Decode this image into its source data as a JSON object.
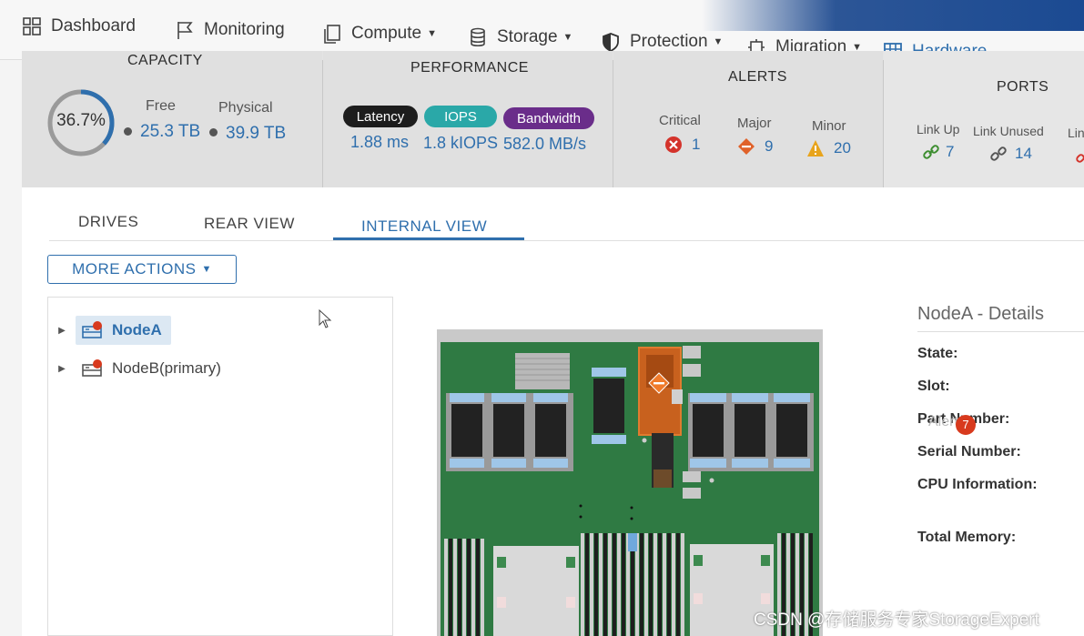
{
  "nav": {
    "items": [
      {
        "label": "Dashboard",
        "icon": "dashboard-grid-icon"
      },
      {
        "label": "Monitoring",
        "icon": "flag-icon"
      },
      {
        "label": "Compute",
        "icon": "copy-icon"
      },
      {
        "label": "Storage",
        "icon": "database-icon"
      },
      {
        "label": "Protection",
        "icon": "shield-icon"
      },
      {
        "label": "Migration",
        "icon": "migration-icon"
      },
      {
        "label": "Hardware",
        "icon": "hardware-grid-icon"
      }
    ],
    "active": "Hardware"
  },
  "capacity": {
    "title": "CAPACITY",
    "percent": "36.7%",
    "percent_value": 36.7,
    "free_label": "Free",
    "free_value": "25.3 TB",
    "physical_label": "Physical",
    "physical_value": "39.9 TB"
  },
  "performance": {
    "title": "PERFORMANCE",
    "latency_label": "Latency",
    "latency_value": "1.88 ms",
    "iops_label": "IOPS",
    "iops_value": "1.8 kIOPS",
    "bandwidth_label": "Bandwidth",
    "bandwidth_value": "582.0 MB/s"
  },
  "alerts": {
    "title": "ALERTS",
    "critical_label": "Critical",
    "critical_value": "1",
    "major_label": "Major",
    "major_value": "9",
    "minor_label": "Minor",
    "minor_value": "20"
  },
  "ports": {
    "title": "PORTS",
    "link_up_label": "Link Up",
    "link_up_value": "7",
    "link_unused_label": "Link Unused",
    "link_unused_value": "14",
    "link_third_label": "Link"
  },
  "tabs": [
    "DRIVES",
    "REAR VIEW",
    "INTERNAL VIEW"
  ],
  "active_tab": "INTERNAL VIEW",
  "more_actions": "MORE ACTIONS",
  "tree": {
    "nodes": [
      {
        "label": "NodeA",
        "selected": true
      },
      {
        "label": "NodeB(primary)",
        "selected": false
      }
    ]
  },
  "details": {
    "title": "NodeA - Details",
    "fields": [
      "State:",
      "Slot:",
      "Part Number:",
      "Serial Number:",
      "CPU Information:",
      "Total Memory:"
    ],
    "alerts_label": "Alerts",
    "alerts_count": "7"
  },
  "watermark": "CSDN @存储服务专家StorageExpert",
  "colors": {
    "accent": "#2f6fad",
    "latency_pill": "#1d1d1d",
    "iops_pill": "#2aa8a8",
    "bandwidth_pill": "#6a2d8a",
    "critical": "#d4332b",
    "major": "#e0622a",
    "minor": "#e8a41c",
    "board_green": "#2f7a43"
  }
}
